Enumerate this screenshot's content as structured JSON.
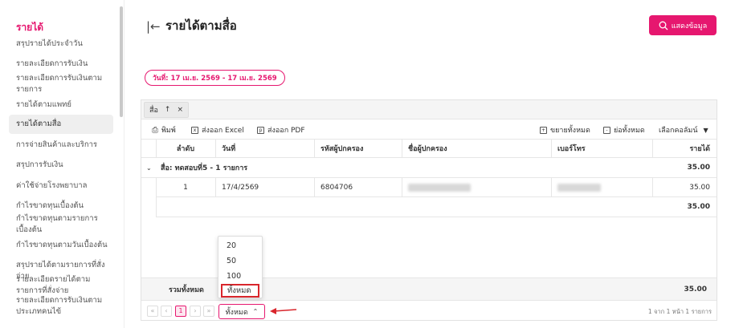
{
  "sidebar": {
    "title": "รายได้",
    "items": [
      "สรุปรายได้ประจำวัน",
      "รายละเอียดการรับเงิน",
      "รายละเอียดการรับเงินตามรายการ",
      "รายได้ตามแพทย์",
      "รายได้ตามสื่อ",
      "การจ่ายสินค้าและบริการ",
      "สรุปการรับเงิน",
      "ค่าใช้จ่ายโรงพยาบาล",
      "กำไรขาดทุนเบื้องต้น",
      "กำไรขาดทุนตามรายการเบื้องต้น",
      "กำไรขาดทุนตามวันเบื้องต้น",
      "สรุปรายได้ตามรายการที่สั่งจ่าย",
      "รายละเอียดรายได้ตามรายการที่สั่งจ่าย",
      "รายละเอียดการรับเงินตามประเภทคนไข้"
    ]
  },
  "header": {
    "title": "รายได้ตามสื่อ",
    "show_button": "แสดงข้อมูล",
    "date_range": "วันที่: 17 เม.ย. 2569 - 17 เม.ย. 2569"
  },
  "grid": {
    "group_chip": "สื่อ",
    "toolbar": {
      "print": "พิมพ์",
      "export_excel": "ส่งออก Excel",
      "export_pdf": "ส่งออก PDF",
      "expand_all": "ขยายทั้งหมด",
      "collapse_all": "ย่อทั้งหมด",
      "choose_columns": "เลือกคอลัมน์"
    },
    "columns": [
      "ลำดับ",
      "วันที่",
      "รหัสผู้ปกครอง",
      "ชื่อผู้ปกครอง",
      "เบอร์โทร",
      "รายได้"
    ],
    "group_label": "สื่อ: ทดสอบที่5 - 1 รายการ",
    "group_total": "35.00",
    "rows": [
      {
        "no": "1",
        "date": "17/4/2569",
        "code": "6804706",
        "amount": "35.00"
      }
    ],
    "subtotal": "35.00",
    "grand_total_label": "รวมทั้งหมด",
    "grand_total": "35.00",
    "pager": {
      "current_page": "1",
      "page_size": "ทั้งหมด",
      "info": "1 จาก 1 หน้า 1 รายการ"
    },
    "page_size_options": [
      "20",
      "50",
      "100",
      "ทั้งหมด"
    ]
  }
}
